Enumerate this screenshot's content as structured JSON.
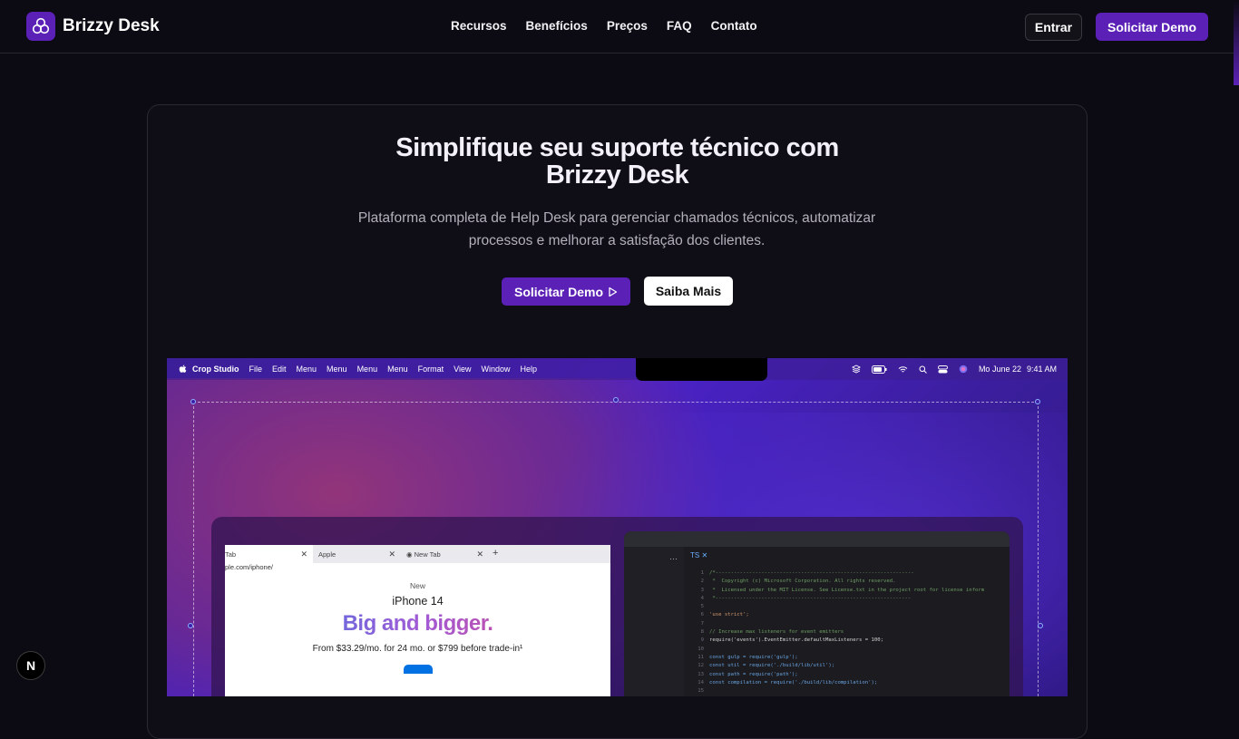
{
  "brand": {
    "name": "Brizzy Desk",
    "accent": "#5b21b6"
  },
  "nav": {
    "items": [
      "Recursos",
      "Benefícios",
      "Preços",
      "FAQ",
      "Contato"
    ]
  },
  "header": {
    "login_label": "Entrar",
    "demo_label": "Solicitar Demo"
  },
  "hero": {
    "title_line1": "Simplifique seu suporte técnico com",
    "title_line2": "Brizzy Desk",
    "subtitle_line1": "Plataforma completa de Help Desk para gerenciar chamados técnicos, automatizar",
    "subtitle_line2": "processos e melhorar a satisfação dos clientes.",
    "primary_cta": "Solicitar Demo",
    "secondary_cta": "Saiba Mais"
  },
  "mockup": {
    "menubar": {
      "app": "Crop Studio",
      "items": [
        "File",
        "Edit",
        "Menu",
        "Menu",
        "Menu",
        "Menu",
        "Format",
        "View",
        "Window",
        "Help"
      ],
      "date": "Mo June 22",
      "time": "9:41 AM"
    },
    "browser": {
      "tabs": [
        {
          "label": "Tab"
        },
        {
          "label": "Apple"
        },
        {
          "label": "New Tab"
        }
      ],
      "url": "ple.com/iphone/",
      "page": {
        "eyebrow": "New",
        "model": "iPhone 14",
        "headline": "Big and bigger.",
        "price": "From $33.29/mo. for 24 mo. or $799 before trade-in¹"
      }
    },
    "editor": {
      "tab_label": "TS ✕",
      "lines": [
        {
          "n": "1",
          "t": "/*-----------------------------------------------------------------",
          "c": "cm"
        },
        {
          "n": "2",
          "t": " *  Copyright (c) Microsoft Corporation. All rights reserved.",
          "c": "cm"
        },
        {
          "n": "3",
          "t": " *  Licensed under the MIT License. See License.txt in the project root for license inform",
          "c": "cm"
        },
        {
          "n": "4",
          "t": " *----------------------------------------------------------------",
          "c": "cm"
        },
        {
          "n": "5",
          "t": "",
          "c": "tx"
        },
        {
          "n": "6",
          "t": "'use strict';",
          "c": "str"
        },
        {
          "n": "7",
          "t": "",
          "c": "tx"
        },
        {
          "n": "8",
          "t": "// Increase max listeners for event emitters",
          "c": "cm"
        },
        {
          "n": "9",
          "t": "require('events').EventEmitter.defaultMaxListeners = 100;",
          "c": "tx"
        },
        {
          "n": "10",
          "t": "",
          "c": "tx"
        },
        {
          "n": "11",
          "t": "const gulp = require('gulp');",
          "c": "kw"
        },
        {
          "n": "12",
          "t": "const util = require('./build/lib/util');",
          "c": "kw"
        },
        {
          "n": "13",
          "t": "const path = require('path');",
          "c": "kw"
        },
        {
          "n": "14",
          "t": "const compilation = require('./build/lib/compilation');",
          "c": "kw"
        },
        {
          "n": "15",
          "t": "",
          "c": "tx"
        }
      ]
    }
  },
  "dev_indicator": {
    "label": "N"
  }
}
